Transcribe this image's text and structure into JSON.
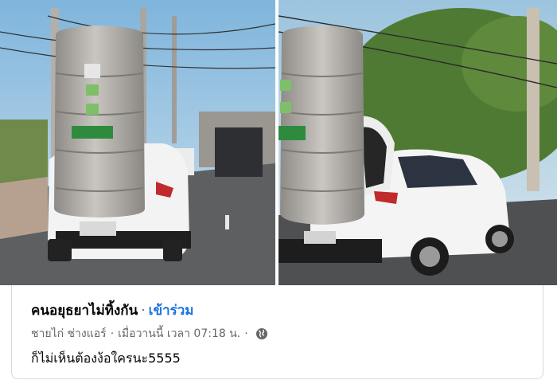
{
  "post": {
    "group_name": "คนอยุธยาไม่ทิ้งกัน",
    "separator": "·",
    "join_label": "เข้าร่วม",
    "author": "ชายไก่ ช่างแอร์",
    "time": "เมื่อวานนี้ เวลา 07:18 น.",
    "caption": "ก็ไม่เห็นต้องง้อใครนะ5555"
  },
  "icons": {
    "privacy": "globe-icon"
  },
  "colors": {
    "link": "#1b74e4",
    "meta": "#65676b",
    "text": "#050505",
    "border": "#d6d9de"
  }
}
